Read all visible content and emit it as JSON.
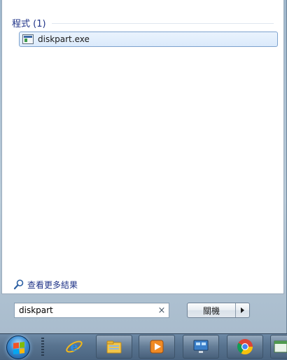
{
  "results": {
    "group_title": "程式 (1)",
    "items": [
      {
        "label": "diskpart.exe",
        "icon": "application-window-icon"
      }
    ],
    "more_results_label": "查看更多結果"
  },
  "search": {
    "value": "diskpart",
    "clear_glyph": "×"
  },
  "shutdown": {
    "label": "關機"
  },
  "taskbar": {
    "items": [
      {
        "icon": "start-orb-icon"
      },
      {
        "icon": "internet-explorer-icon"
      },
      {
        "icon": "file-explorer-icon"
      },
      {
        "icon": "media-player-icon"
      },
      {
        "icon": "remote-desktop-icon"
      },
      {
        "icon": "chrome-icon"
      },
      {
        "icon": "window-app-icon"
      }
    ]
  },
  "colors": {
    "group_title": "#1e3287",
    "highlight_border": "#7da2ce",
    "taskbar": "#58738f"
  }
}
